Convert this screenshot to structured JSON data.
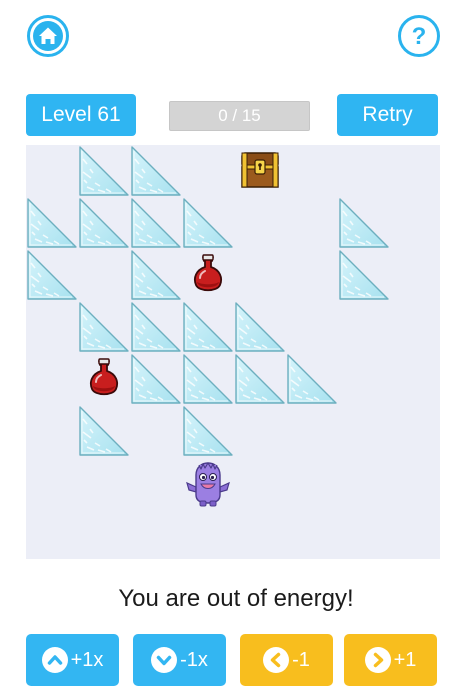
{
  "header": {
    "home_icon": "home-icon",
    "help_icon": "help-icon",
    "accent_color": "#2fb5f2"
  },
  "toolbar": {
    "level_label": "Level 61",
    "progress_text": "0 / 15",
    "retry_label": "Retry"
  },
  "board": {
    "grid_size": 8,
    "background": "#eceef7",
    "ice_blocks": [
      [
        0,
        1
      ],
      [
        0,
        2
      ],
      [
        1,
        0
      ],
      [
        1,
        1
      ],
      [
        1,
        2
      ],
      [
        1,
        3
      ],
      [
        1,
        6
      ],
      [
        2,
        0
      ],
      [
        2,
        2
      ],
      [
        2,
        6
      ],
      [
        3,
        1
      ],
      [
        3,
        2
      ],
      [
        3,
        3
      ],
      [
        3,
        4
      ],
      [
        4,
        2
      ],
      [
        4,
        3
      ],
      [
        4,
        4
      ],
      [
        4,
        5
      ],
      [
        5,
        1
      ],
      [
        5,
        3
      ]
    ],
    "treasure_chest": [
      0,
      4
    ],
    "potions": [
      [
        2,
        3
      ],
      [
        4,
        1
      ]
    ],
    "player": [
      6,
      3
    ]
  },
  "status": {
    "message": "You are out of energy!"
  },
  "controls": [
    {
      "label": "+1x",
      "icon": "chevron-up-icon",
      "color": "#33b6f2"
    },
    {
      "label": "-1x",
      "icon": "chevron-down-icon",
      "color": "#33b6f2"
    },
    {
      "label": "-1",
      "icon": "chevron-left-icon",
      "color": "#f8be1e"
    },
    {
      "label": "+1",
      "icon": "chevron-right-icon",
      "color": "#f8be1e"
    }
  ]
}
